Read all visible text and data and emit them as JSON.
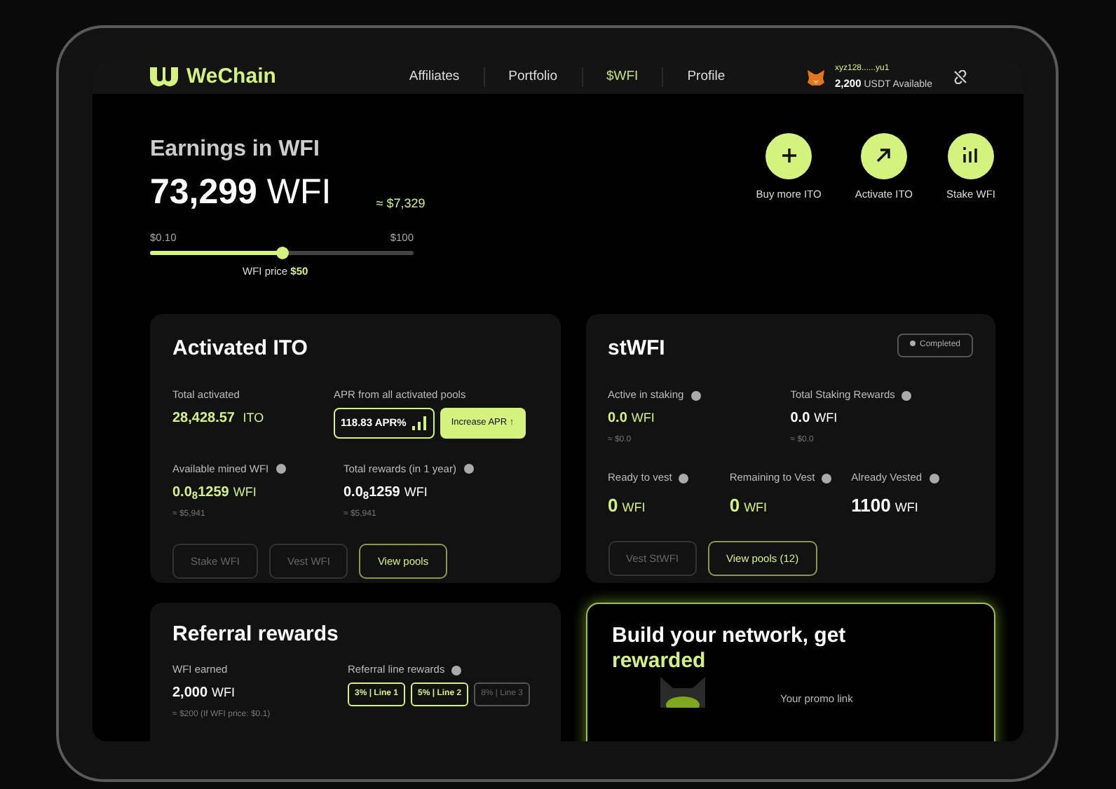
{
  "header": {
    "logo": "WeChain",
    "nav": [
      {
        "label": "Affiliates",
        "selected": false
      },
      {
        "label": "Portfolio",
        "selected": false
      },
      {
        "label": "$WFI",
        "selected": true
      },
      {
        "label": "Profile",
        "selected": false
      }
    ],
    "wallet": {
      "address": "xyz128......yu1",
      "balance": "2,200",
      "balance_unit": "USDT Available"
    }
  },
  "earnings": {
    "title": "Earnings in WFI",
    "amount": "73,299",
    "unit": "WFI",
    "usd": "≈ $7,329",
    "slider": {
      "min": "$0.10",
      "max": "$100",
      "level": 0.5,
      "caption": "WFI price **$50**"
    }
  },
  "actions": [
    {
      "kind": "plus",
      "label": "Buy more ITO"
    },
    {
      "kind": "arrow",
      "label": "Activate ITO"
    },
    {
      "kind": "bars",
      "label": "Stake WFI"
    }
  ],
  "activated_ito": {
    "title": "Activated ITO",
    "total_label": "Total activated",
    "total_value": "28,428.57",
    "total_unit": "ITO",
    "apr_label": "APR from all activated pools",
    "apr_value": "118.83 APR%",
    "increase_button": "Increase APR ↑",
    "stats": [
      {
        "label": "Available mined WFI",
        "value": "0.0$_{8}$1259",
        "unit": "WFI",
        "usd": "≈ $5,941",
        "highlight": true
      },
      {
        "label": "Total rewards (in 1 year)",
        "value": "0.0$_{8}$1259",
        "unit": "WFI",
        "usd": "≈ $5,941",
        "highlight": false
      }
    ],
    "buttons": [
      {
        "label": "Stake WFI",
        "disabled": true
      },
      {
        "label": "Vest WFI",
        "disabled": true
      },
      {
        "label": "View pools",
        "disabled": false
      }
    ]
  },
  "stwfi": {
    "title": "stWFI",
    "status": "Completed",
    "stats": [
      {
        "label": "Active in staking",
        "value": "0.0",
        "unit": "WFI",
        "usd": "≈ $0.0",
        "highlight": true
      },
      {
        "label": "Total Staking Rewards",
        "value": "0.0",
        "unit": "WFI",
        "usd": "≈ $0.0",
        "highlight": false
      }
    ],
    "vest": [
      {
        "label": "Ready to vest",
        "value": "0",
        "unit": "WFI",
        "highlight": true
      },
      {
        "label": "Remaining to Vest",
        "value": "0",
        "unit": "WFI",
        "highlight": true
      },
      {
        "label": "Already Vested",
        "value": "1100",
        "unit": "WFI",
        "highlight": false
      }
    ],
    "buttons": [
      {
        "label": "Vest StWFI",
        "disabled": true
      },
      {
        "label": "View pools (12)",
        "disabled": false
      }
    ]
  },
  "referral": {
    "title": "Referral rewards",
    "earned_label": "WFI earned",
    "earned_value": "2,000",
    "earned_unit": "WFI",
    "earned_note": "≈ $200 (If WFI price: $0.1)",
    "lines_label": "Referral line rewards",
    "lines": [
      {
        "label": "3% | Line 1",
        "active": true
      },
      {
        "label": "5% | Line 2",
        "active": true
      },
      {
        "label": "8% | Line 3",
        "active": false
      }
    ]
  },
  "network": {
    "title": "Build your network, get",
    "highlight": "rewarded",
    "promo_label": "Your promo link"
  }
}
